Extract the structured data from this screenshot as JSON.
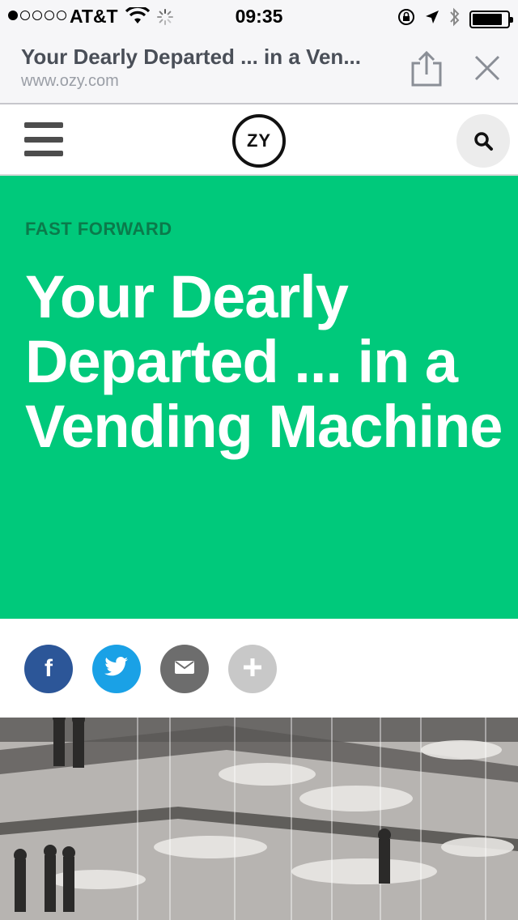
{
  "status_bar": {
    "carrier": "AT&T",
    "time": "09:35",
    "signal_bars_filled": 1,
    "signal_bars_total": 5,
    "battery_level": 0.85
  },
  "browser": {
    "page_title": "Your Dearly Departed ... in a Ven...",
    "domain": "www.ozy.com"
  },
  "site": {
    "logo_text": "ZY"
  },
  "article": {
    "section": "FAST FORWARD",
    "headline": "Your Dearly Departed ... in a Vending Machine",
    "accent_color": "#00c97b"
  },
  "share": {
    "facebook_glyph": "f",
    "twitter_icon": "twitter-bird-icon",
    "email_icon": "envelope-icon",
    "more_icon": "plus-icon"
  },
  "icons": {
    "hamburger": "menu-icon",
    "search": "search-icon",
    "browser_share": "share-icon",
    "browser_close": "close-icon"
  }
}
